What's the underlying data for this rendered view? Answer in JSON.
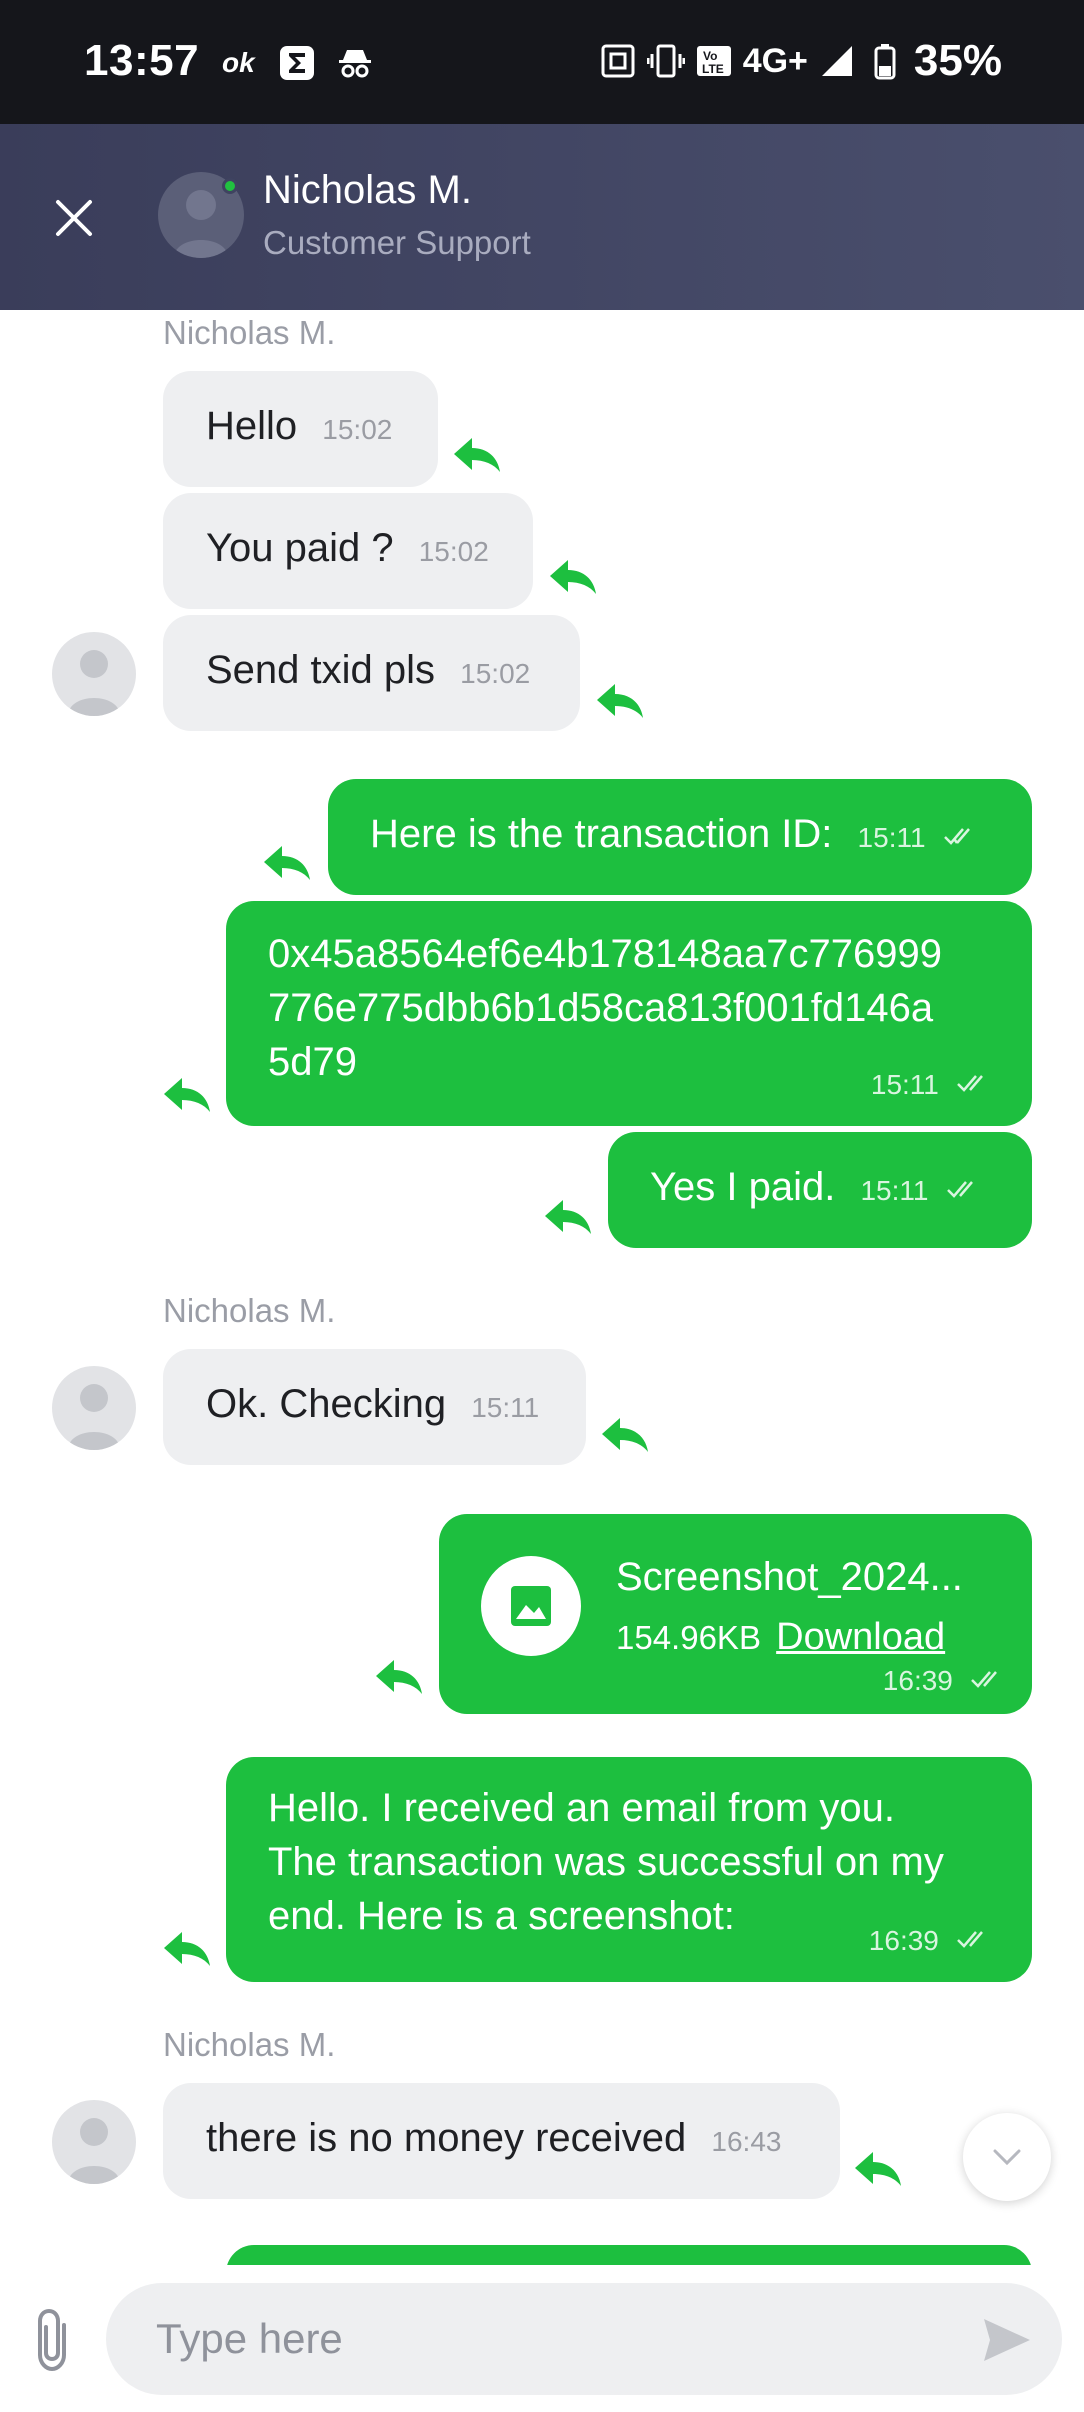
{
  "status_bar": {
    "time": "13:57",
    "network": "4G+",
    "battery": "35%",
    "left_icons": [
      "ok-icon",
      "sigma-icon",
      "incognito-icon"
    ],
    "right_icons": [
      "nfc-icon",
      "vibrate-icon",
      "volte-icon",
      "signal-icon",
      "battery-icon"
    ]
  },
  "header": {
    "name": "Nicholas M.",
    "subtitle": "Customer Support",
    "online_color": "#21c140"
  },
  "colors": {
    "outgoing_bubble": "#1dbf3f",
    "incoming_bubble": "#eeeff1",
    "header_bg": "#3f4360",
    "reply_icon": "#1dbf3f"
  },
  "messages": [
    {
      "sender": "Nicholas M.",
      "text": "Hello",
      "time": "15:02",
      "direction": "in"
    },
    {
      "text": "You paid ?",
      "time": "15:02",
      "direction": "in"
    },
    {
      "text": "Send txid pls",
      "time": "15:02",
      "direction": "in"
    },
    {
      "text": "Here is the transaction ID:",
      "time": "15:11",
      "direction": "out",
      "status": "read"
    },
    {
      "line1": "0x45a8564ef6e4b178148aa7c776999",
      "line2": "776e775dbb6b1d58ca813f001fd146a",
      "line3": "5d79",
      "time": "15:11",
      "direction": "out",
      "status": "read"
    },
    {
      "text": "Yes I paid.",
      "time": "15:11",
      "direction": "out",
      "status": "read"
    },
    {
      "sender": "Nicholas M.",
      "text": "Ok. Checking",
      "time": "15:11",
      "direction": "in"
    },
    {
      "file_name": "Screenshot_2024...",
      "file_size": "154.96KB",
      "download_label": "Download",
      "time": "16:39",
      "direction": "out",
      "status": "read"
    },
    {
      "line1": "Hello. I received an email from you.",
      "line2": "The transaction was successful on my",
      "line3": "end. Here is a screenshot:",
      "time": "16:39",
      "direction": "out",
      "status": "read"
    },
    {
      "sender": "Nicholas M.",
      "text": "there is no money received",
      "time": "16:43",
      "direction": "in"
    }
  ],
  "composer": {
    "placeholder": "Type here"
  }
}
